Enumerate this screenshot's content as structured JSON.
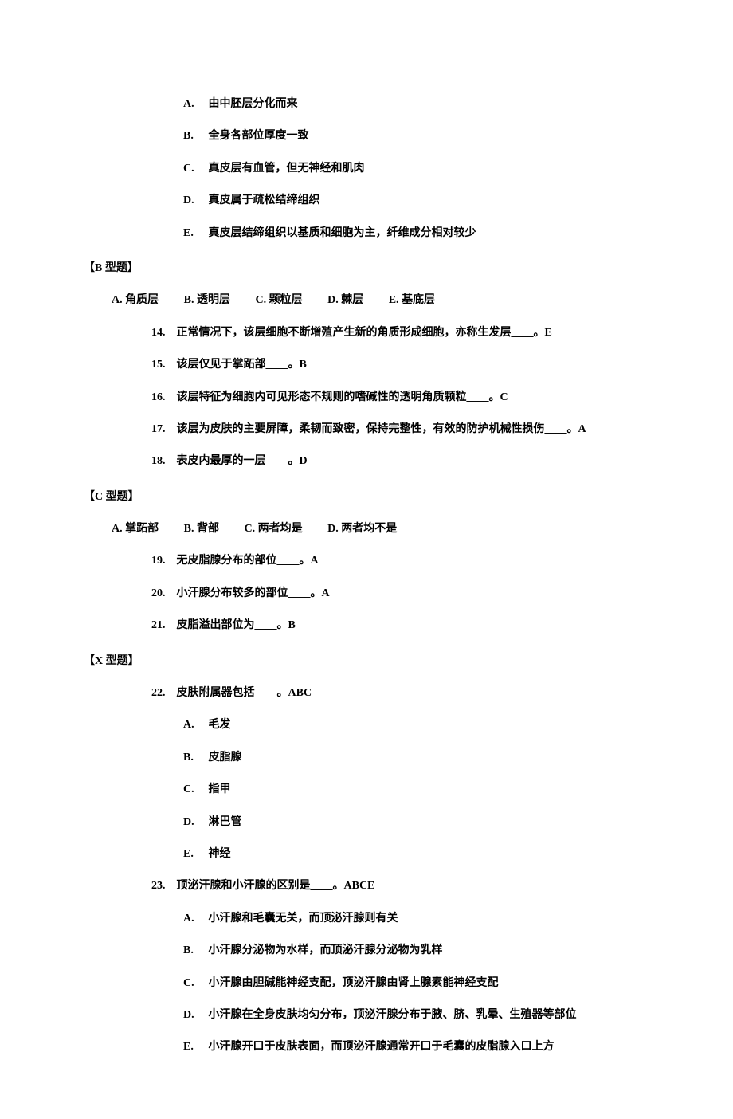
{
  "optionsTop": [
    {
      "marker": "A.",
      "text": "由中胚层分化而来"
    },
    {
      "marker": "B.",
      "text": "全身各部位厚度一致"
    },
    {
      "marker": "C.",
      "text": "真皮层有血管，但无神经和肌肉"
    },
    {
      "marker": "D.",
      "text": "真皮属于疏松结缔组织"
    },
    {
      "marker": "E.",
      "text": "真皮层结缔组织以基质和细胞为主，纤维成分相对较少"
    }
  ],
  "sectionB": {
    "title": "【B 型题】",
    "choices": [
      {
        "label": "A.",
        "text": "角质层"
      },
      {
        "label": "B.",
        "text": "透明层"
      },
      {
        "label": "C.",
        "text": "颗粒层"
      },
      {
        "label": "D.",
        "text": "棘层"
      },
      {
        "label": "E.",
        "text": "基底层"
      }
    ],
    "questions": [
      {
        "num": "14.",
        "text": "正常情况下，该层细胞不断增殖产生新的角质形成细胞，亦称生发层____。E"
      },
      {
        "num": "15.",
        "text": "该层仅见于掌跖部____。B"
      },
      {
        "num": "16.",
        "text": "该层特征为细胞内可见形态不规则的嗜碱性的透明角质颗粒____。C"
      },
      {
        "num": "17.",
        "text": "该层为皮肤的主要屏障，柔韧而致密，保持完整性，有效的防护机械性损伤____。A"
      },
      {
        "num": "18.",
        "text": "表皮内最厚的一层____。D"
      }
    ]
  },
  "sectionC": {
    "title": "【C 型题】",
    "choices": [
      {
        "label": "A.",
        "text": "掌跖部"
      },
      {
        "label": "B.",
        "text": "背部"
      },
      {
        "label": "C.",
        "text": "两者均是"
      },
      {
        "label": "D.",
        "text": "两者均不是"
      }
    ],
    "questions": [
      {
        "num": "19.",
        "text": "无皮脂腺分布的部位____。A"
      },
      {
        "num": "20.",
        "text": "小汗腺分布较多的部位____。A"
      },
      {
        "num": "21.",
        "text": "皮脂溢出部位为____。B"
      }
    ]
  },
  "sectionX": {
    "title": "【X 型题】",
    "q22": {
      "num": "22.",
      "text": "皮肤附属器包括____。ABC",
      "options": [
        {
          "marker": "A.",
          "text": "毛发"
        },
        {
          "marker": "B.",
          "text": "皮脂腺"
        },
        {
          "marker": "C.",
          "text": "指甲"
        },
        {
          "marker": "D.",
          "text": "淋巴管"
        },
        {
          "marker": "E.",
          "text": "神经"
        }
      ]
    },
    "q23": {
      "num": "23.",
      "text": "顶泌汗腺和小汗腺的区别是____。ABCE",
      "options": [
        {
          "marker": "A.",
          "text": "小汗腺和毛囊无关，而顶泌汗腺则有关"
        },
        {
          "marker": "B.",
          "text": "小汗腺分泌物为水样，而顶泌汗腺分泌物为乳样"
        },
        {
          "marker": "C.",
          "text": "小汗腺由胆碱能神经支配，顶泌汗腺由肾上腺素能神经支配"
        },
        {
          "marker": "D.",
          "text": "小汗腺在全身皮肤均匀分布，顶泌汗腺分布于腋、脐、乳晕、生殖器等部位"
        },
        {
          "marker": "E.",
          "text": "小汗腺开口于皮肤表面，而顶泌汗腺通常开口于毛囊的皮脂腺入口上方"
        }
      ]
    }
  }
}
